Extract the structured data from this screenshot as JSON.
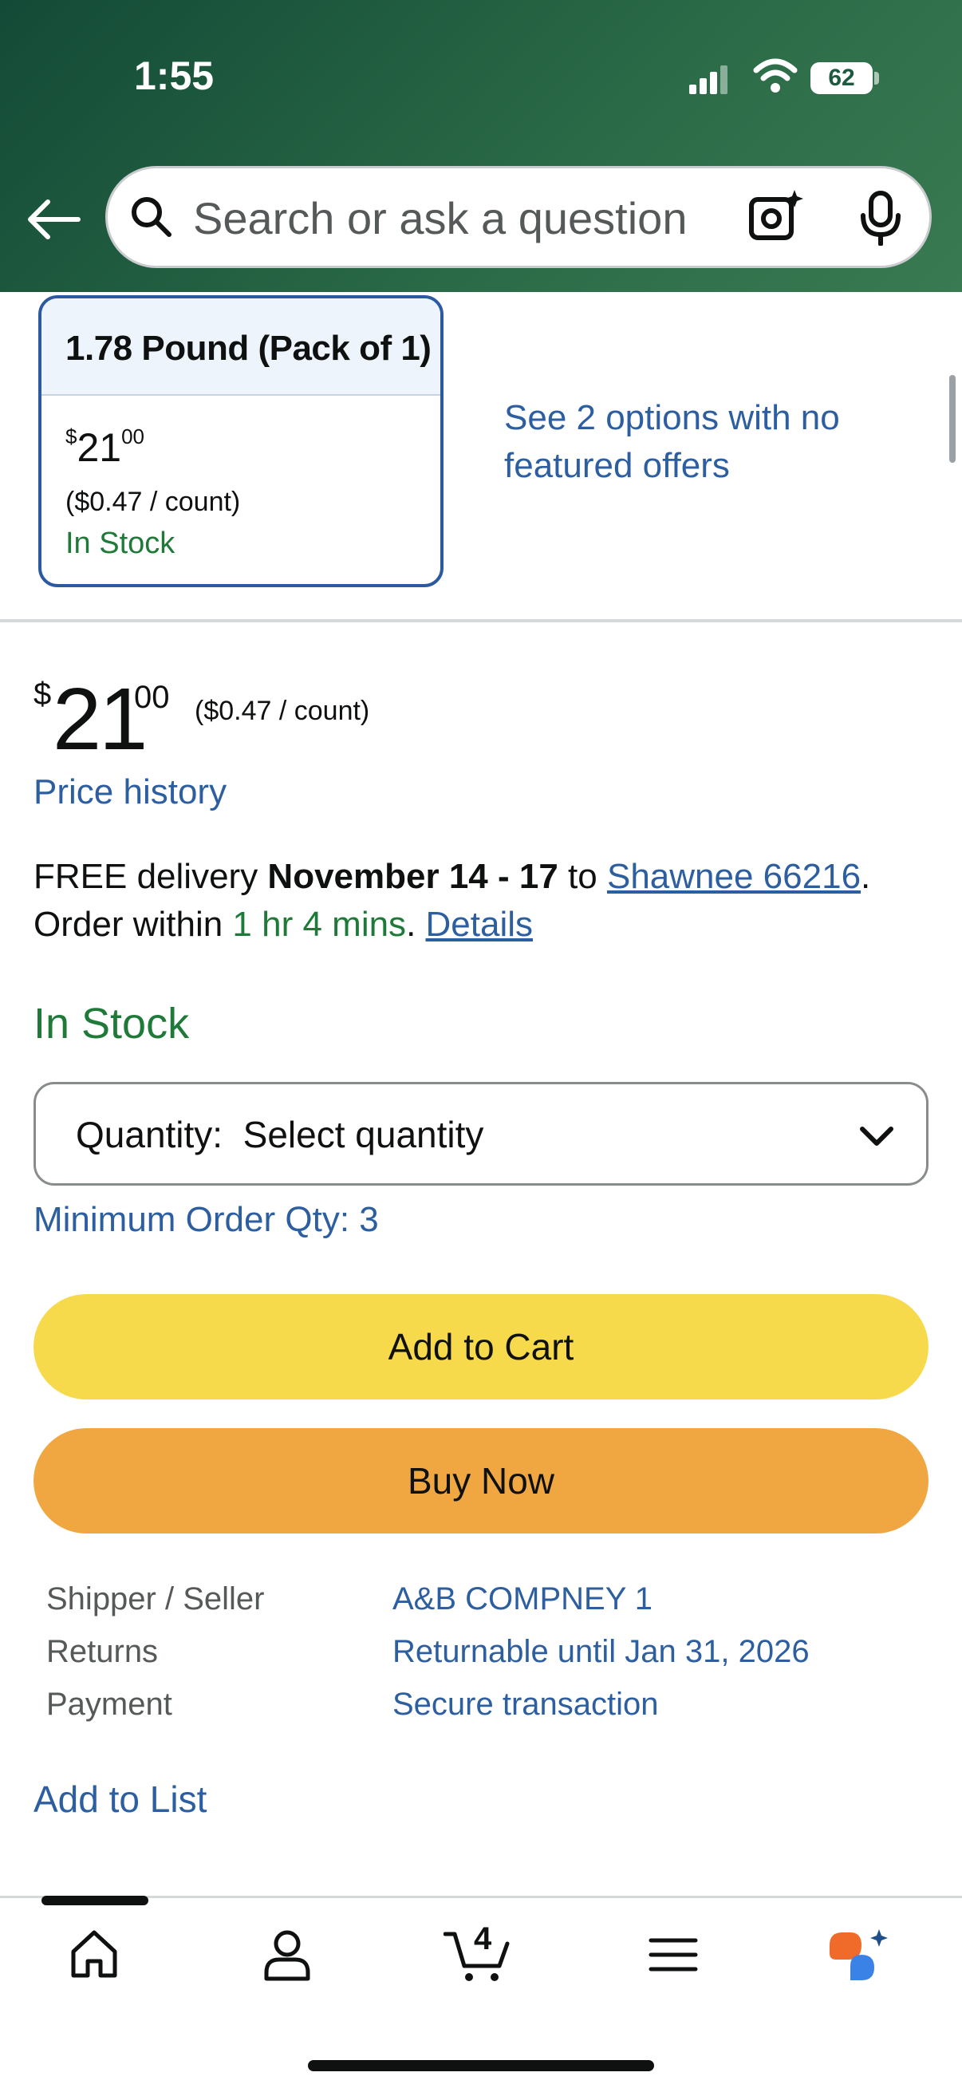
{
  "status_bar": {
    "time": "1:55",
    "battery": "62"
  },
  "header": {
    "search_placeholder": "Search or ask a question"
  },
  "variant": {
    "title": "1.78 Pound (Pack of 1)",
    "price_whole": "21",
    "price_fraction": "00",
    "price_symbol": "$",
    "unit_price": "($0.47 / count)",
    "stock": "In Stock",
    "more_options": "See 2 options with no featured offers"
  },
  "price": {
    "symbol": "$",
    "whole": "21",
    "fraction": "00",
    "unit_price": "($0.47 / count)",
    "history_link": "Price history"
  },
  "delivery": {
    "prefix": "FREE delivery ",
    "dates": "November 14 - 17",
    "to": " to ",
    "location": "Shawnee 66216",
    "period": ".",
    "order_within": "Order within ",
    "countdown": "1 hr 4 mins",
    "period2": ". ",
    "details": "Details"
  },
  "stock_status": "In Stock",
  "quantity": {
    "label": "Quantity:  Select quantity"
  },
  "min_order": "Minimum Order Qty: 3",
  "buttons": {
    "add_to_cart": "Add to Cart",
    "buy_now": "Buy Now"
  },
  "info": [
    {
      "label": "Shipper / Seller",
      "value": "A&B COMPNEY 1"
    },
    {
      "label": "Returns",
      "value": "Returnable until Jan 31, 2026"
    },
    {
      "label": "Payment",
      "value": "Secure transaction"
    }
  ],
  "add_to_list": "Add to List",
  "bottom_nav": {
    "cart_count": "4",
    "items": [
      "home-icon",
      "account-icon",
      "cart-icon",
      "menu-icon",
      "rufus-icon"
    ]
  },
  "colors": {
    "header_green": "#2b6b47",
    "link_blue": "#2d5fa0",
    "stock_green": "#1f7a3a",
    "add_to_cart": "#f7d94c",
    "buy_now": "#f0a742"
  }
}
